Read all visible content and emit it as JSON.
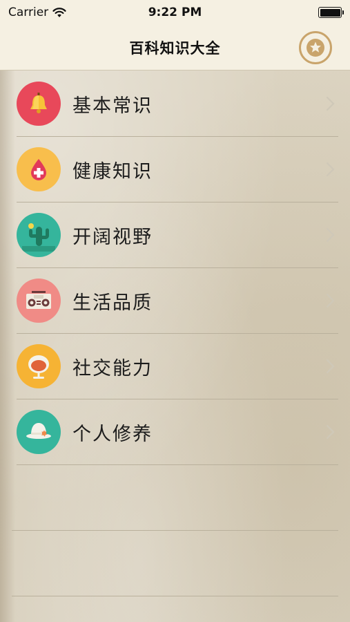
{
  "status_bar": {
    "carrier": "Carrier",
    "time": "9:22 PM"
  },
  "nav": {
    "title": "百科知识大全",
    "favorite_icon": "star-icon"
  },
  "menu": {
    "items": [
      {
        "label": "基本常识",
        "icon": "bell-icon",
        "color": "#e8485a"
      },
      {
        "label": "健康知识",
        "icon": "blood-drop-icon",
        "color": "#f8be4c"
      },
      {
        "label": "开阔视野",
        "icon": "cactus-icon",
        "color": "#35b59c"
      },
      {
        "label": "生活品质",
        "icon": "radio-icon",
        "color": "#f08b86"
      },
      {
        "label": "社交能力",
        "icon": "egg-chair-icon",
        "color": "#f6b334"
      },
      {
        "label": "个人修养",
        "icon": "sun-hat-icon",
        "color": "#35b59c"
      }
    ]
  },
  "colors": {
    "nav_background": "#f5f0e2",
    "star_accent": "#c9a46b",
    "separator": "#b9b09c"
  }
}
